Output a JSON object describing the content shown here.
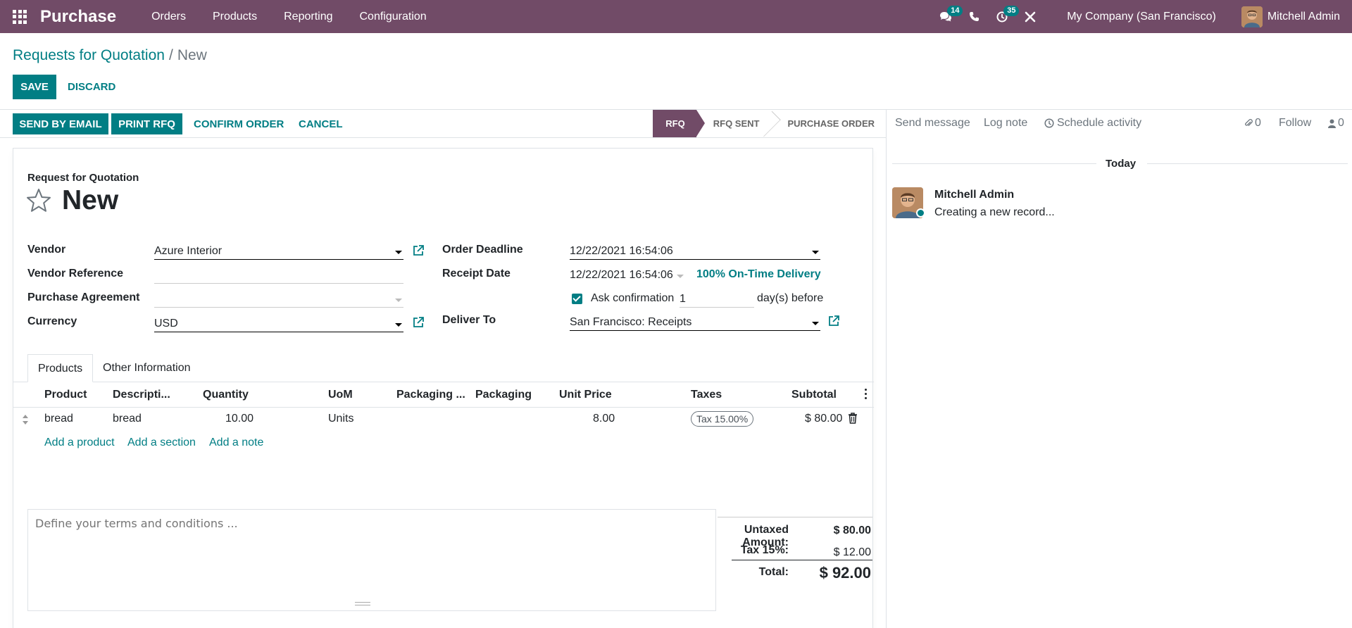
{
  "navbar": {
    "app_name": "Purchase",
    "menu": [
      "Orders",
      "Products",
      "Reporting",
      "Configuration"
    ],
    "messages_count": "14",
    "activities_count": "35",
    "company": "My Company (San Francisco)",
    "user": "Mitchell Admin",
    "icons": [
      "apps-grid-icon",
      "chat-icon",
      "phone-icon",
      "clock-icon",
      "tools-icon"
    ]
  },
  "breadcrumb": {
    "parent": "Requests for Quotation",
    "current": "New"
  },
  "control": {
    "save": "Save",
    "discard": "Discard"
  },
  "statusbar": {
    "buttons": [
      "Send by Email",
      "Print RFQ",
      "Confirm Order",
      "Cancel"
    ],
    "stages": [
      "RFQ",
      "RFQ Sent",
      "Purchase Order"
    ],
    "active_stage": "RFQ"
  },
  "form": {
    "kind": "Request for Quotation",
    "name": "New",
    "fields": {
      "vendor_label": "Vendor",
      "vendor_value": "Azure Interior",
      "vendor_ref_label": "Vendor Reference",
      "vendor_ref_value": "",
      "agreement_label": "Purchase Agreement",
      "agreement_value": "",
      "currency_label": "Currency",
      "currency_value": "USD",
      "deadline_label": "Order Deadline",
      "deadline_value": "12/22/2021 16:54:06",
      "receipt_label": "Receipt Date",
      "receipt_value": "12/22/2021 16:54:06",
      "on_time": "100% On-Time Delivery",
      "ask_confirmation_label": "Ask confirmation",
      "ask_confirmation_checked": true,
      "ask_days": "1",
      "days_before": "day(s) before",
      "deliver_to_label": "Deliver To",
      "deliver_to_value": "San Francisco: Receipts"
    }
  },
  "tabs": [
    "Products",
    "Other Information"
  ],
  "lines": {
    "headers": [
      "Product",
      "Descripti...",
      "Quantity",
      "UoM",
      "Packaging ...",
      "Packaging",
      "Unit Price",
      "Taxes",
      "Subtotal"
    ],
    "rows": [
      {
        "product": "bread",
        "description": "bread",
        "quantity": "10.00",
        "uom": "Units",
        "unit_price": "8.00",
        "taxes": "Tax 15.00%",
        "subtotal": "$ 80.00"
      }
    ],
    "add_links": [
      "Add a product",
      "Add a section",
      "Add a note"
    ]
  },
  "notes": {
    "placeholder": "Define your terms and conditions ..."
  },
  "totals": {
    "untaxed_label": "Untaxed Amount:",
    "untaxed_value": "$ 80.00",
    "tax_label": "Tax 15%:",
    "tax_value": "$ 12.00",
    "total_label": "Total:",
    "total_value": "$ 92.00"
  },
  "chatter": {
    "send_message": "Send message",
    "log_note": "Log note",
    "schedule_activity": "Schedule activity",
    "attachments_count": "0",
    "follow": "Follow",
    "followers_count": "0",
    "date_separator": "Today",
    "message_author": "Mitchell Admin",
    "message_body": "Creating a new record..."
  },
  "colors": {
    "brand": "#714b67",
    "accent": "#017e84"
  }
}
